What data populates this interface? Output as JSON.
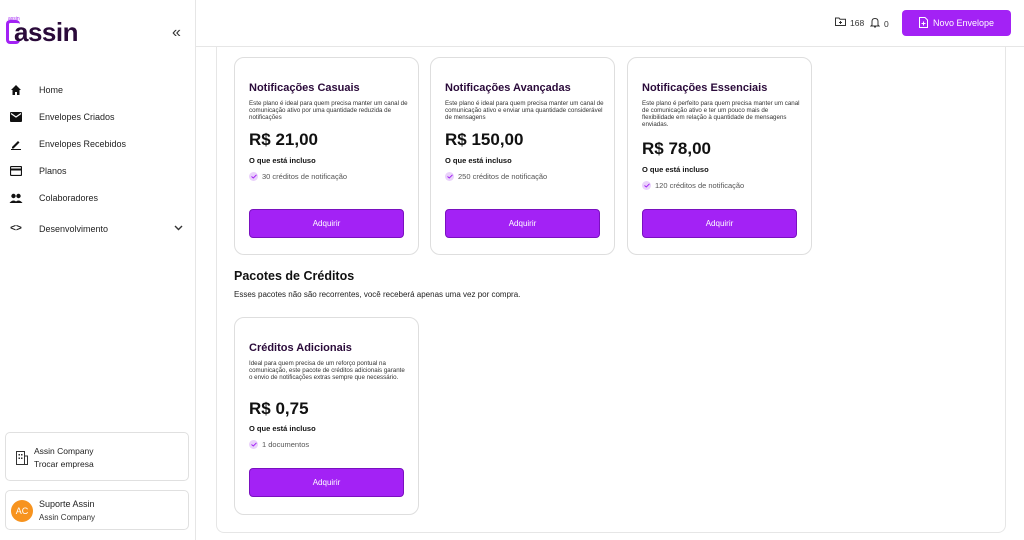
{
  "logo": {
    "text": "assin",
    "small": "assin"
  },
  "sidebar": {
    "items": [
      {
        "label": "Home"
      },
      {
        "label": "Envelopes Criados"
      },
      {
        "label": "Envelopes Recebidos"
      },
      {
        "label": "Planos"
      },
      {
        "label": "Colaboradores"
      },
      {
        "label": "Desenvolvimento"
      }
    ],
    "company": {
      "name": "Assin Company",
      "switch_label": "Trocar empresa"
    },
    "user": {
      "initials": "AC",
      "name": "Suporte Assin",
      "company": "Assin Company"
    }
  },
  "topbar": {
    "envelopes_count": "168",
    "notifications_count": "0",
    "new_envelope_label": "Novo Envelope"
  },
  "plans": [
    {
      "title": "Notificações Casuais",
      "description": "Este plano é ideal para quem precisa manter um canal de comunicação ativo por uma quantidade reduzida de notificações",
      "price": "R$ 21,00",
      "included_label": "O que está incluso",
      "feature": "30 créditos de notificação",
      "button": "Adquirir"
    },
    {
      "title": "Notificações Avançadas",
      "description": "Este plano é ideal para quem precisa manter um canal de comunicação ativo e enviar uma quantidade considerável de mensagens",
      "price": "R$ 150,00",
      "included_label": "O que está incluso",
      "feature": "250 créditos de notificação",
      "button": "Adquirir"
    },
    {
      "title": "Notificações Essenciais",
      "description": "Este plano é perfeito para quem precisa manter um canal de comunicação ativo e ter um pouco mais de flexibilidade em relação à quantidade de mensagens enviadas.",
      "price": "R$ 78,00",
      "included_label": "O que está incluso",
      "feature": "120 créditos de notificação",
      "button": "Adquirir"
    }
  ],
  "credits_section": {
    "title": "Pacotes de Créditos",
    "subtitle": "Esses pacotes não são recorrentes, você receberá apenas uma vez por compra."
  },
  "credit_pack": {
    "title": "Créditos Adicionais",
    "description": "Ideal para quem precisa de um reforço pontual na comunicação, este pacote de créditos adicionais garante o envio de notificações extras sempre que necessário.",
    "price": "R$ 0,75",
    "included_label": "O que está incluso",
    "feature": "1 documentos",
    "button": "Adquirir"
  },
  "colors": {
    "accent": "#a322f5",
    "brand_dark": "#2a0a3a",
    "avatar": "#f7931e"
  }
}
